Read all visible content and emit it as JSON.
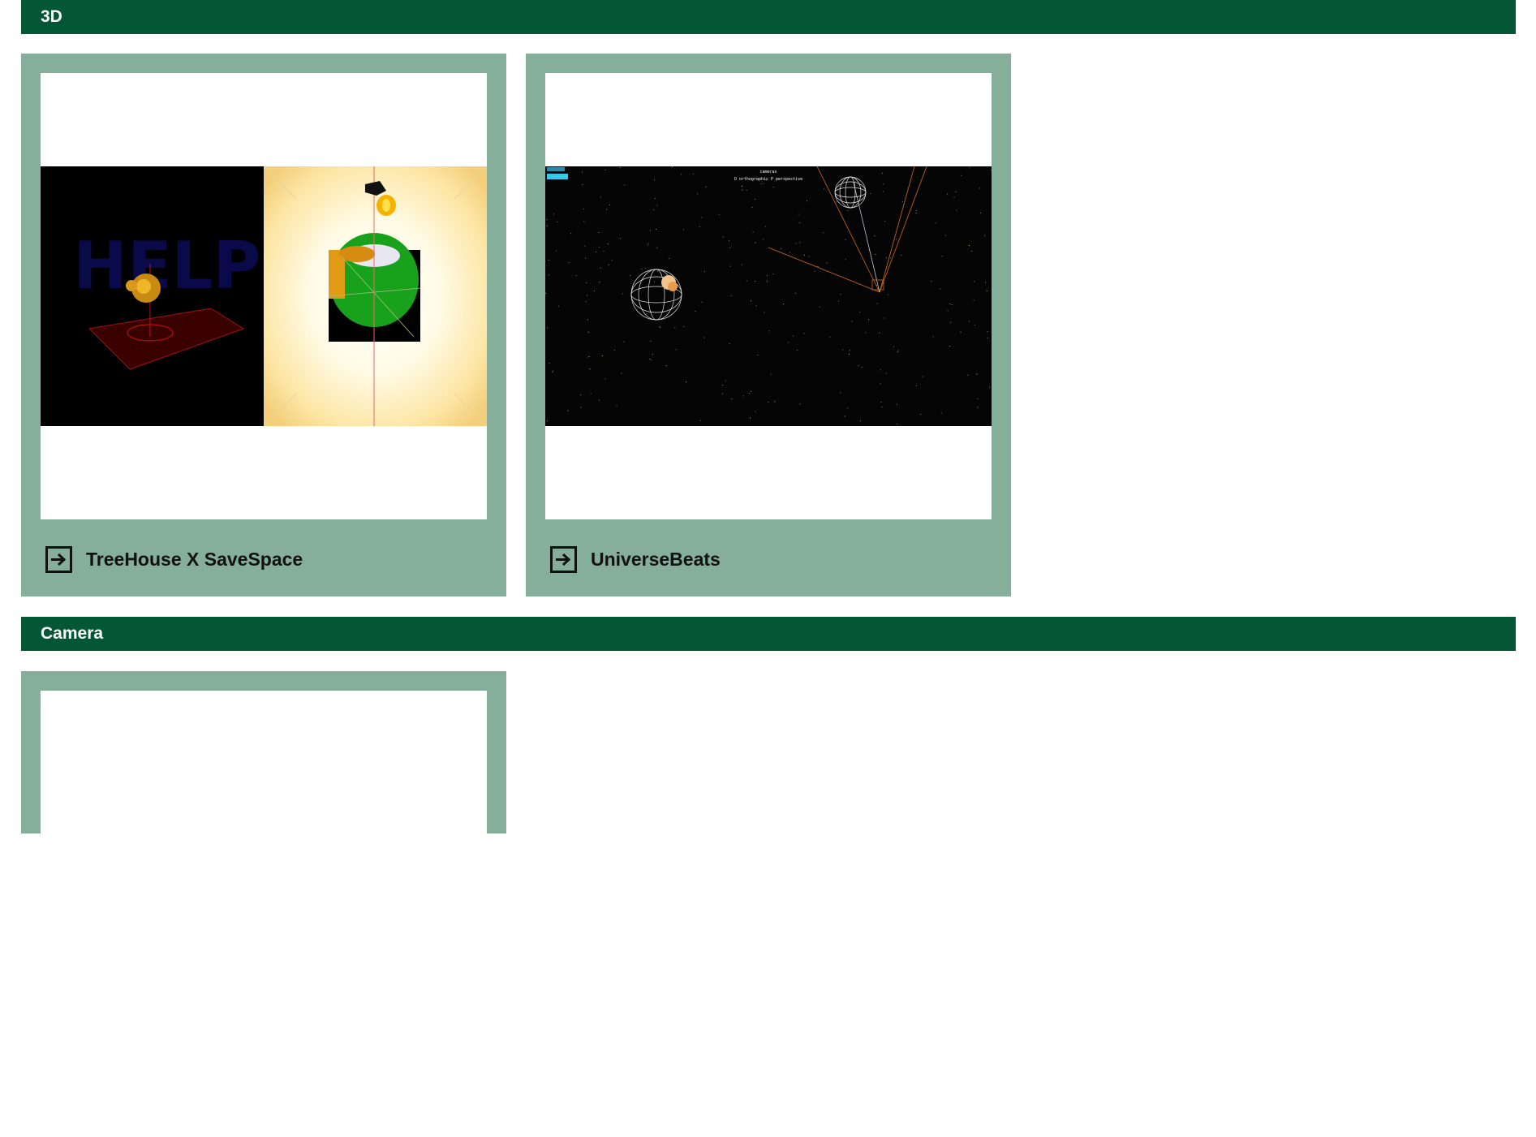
{
  "sections": [
    {
      "title": "3D",
      "cards": [
        {
          "title": "TreeHouse X SaveSpace",
          "link_icon": "arrow-right-square-icon"
        },
        {
          "title": "UniverseBeats",
          "link_icon": "arrow-right-square-icon",
          "overlay": {
            "heading": "cameras",
            "options": "O orthographic P perspective"
          }
        }
      ]
    },
    {
      "title": "Camera",
      "cards": [
        {
          "title": ""
        }
      ]
    }
  ],
  "colors": {
    "header_bg": "#045735",
    "card_bg": "#85ae9b",
    "header_text": "#ffffff"
  }
}
